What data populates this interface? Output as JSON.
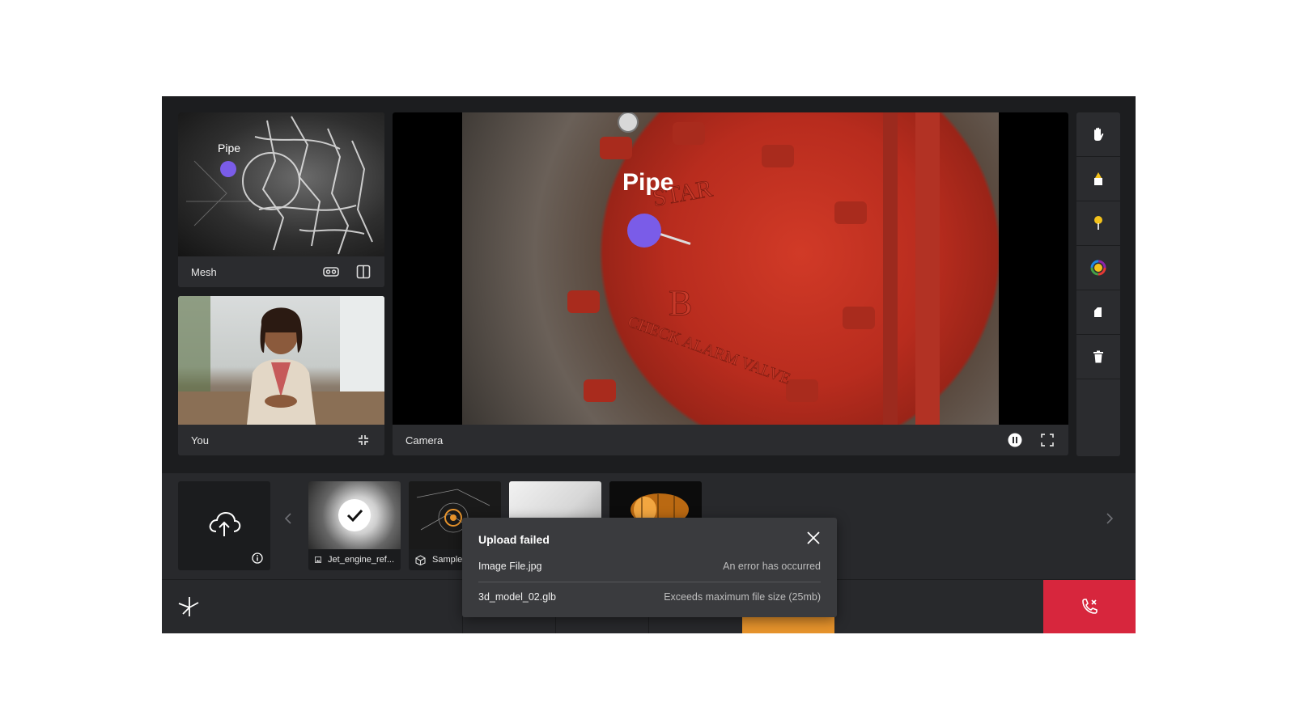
{
  "mesh": {
    "label": "Mesh",
    "pin_label": "Pipe"
  },
  "you": {
    "label": "You"
  },
  "camera": {
    "label": "Camera",
    "pin_label": "Pipe",
    "valve_markings": [
      "STAR",
      "B",
      "CHECK ALARM VALVE"
    ]
  },
  "tools": [
    "hand-icon",
    "cone-marker-icon",
    "pin-icon",
    "color-ring-icon",
    "eraser-icon",
    "trash-icon"
  ],
  "tray": {
    "items": [
      {
        "name": "Jet_engine_ref...",
        "type": "image",
        "selected": true
      },
      {
        "name": "Sample",
        "type": "3d-model",
        "selected": false
      },
      {
        "name": "",
        "type": "image",
        "selected": false
      },
      {
        "name": "",
        "type": "3d-model",
        "selected": false
      }
    ]
  },
  "toast": {
    "title": "Upload failed",
    "rows": [
      {
        "file": "Image File.jpg",
        "error": "An error has occurred"
      },
      {
        "file": "3d_model_02.glb",
        "error": "Exceeds maximum file size (25mb)"
      }
    ]
  },
  "colors": {
    "accent": "#7a5ce8",
    "end_call": "#d7263d",
    "active_tab": "#e8942c",
    "panel": "#2b2c2f",
    "background": "#1c1d1f"
  }
}
